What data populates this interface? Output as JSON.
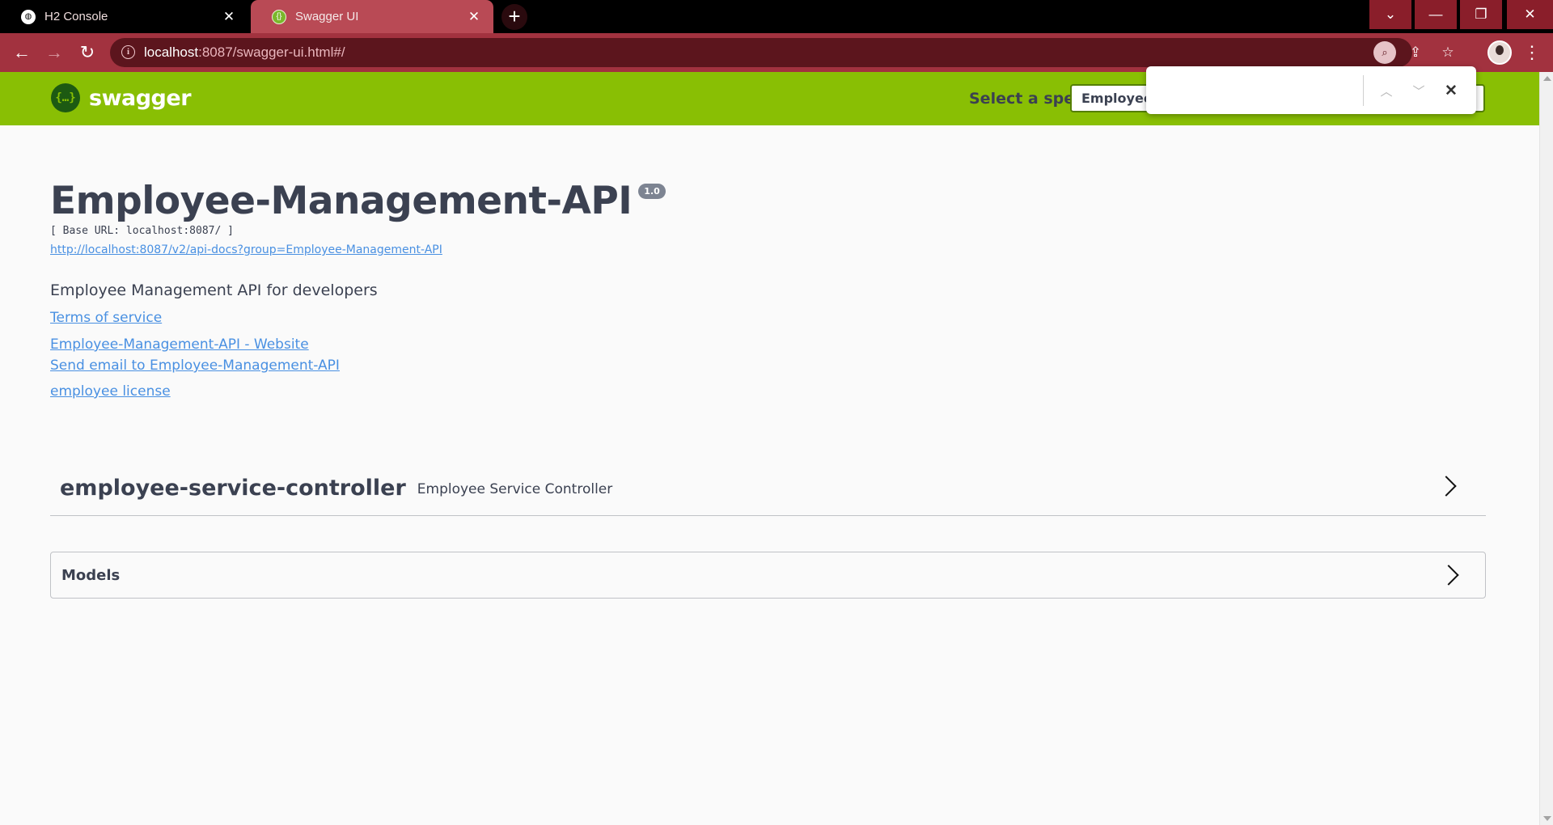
{
  "browser": {
    "tabs": [
      {
        "title": "H2 Console",
        "icon": "globe-icon",
        "active": false
      },
      {
        "title": "Swagger UI",
        "icon": "swagger-icon",
        "active": true
      }
    ],
    "url_host": "localhost",
    "url_rest": ":8087/swagger-ui.html#/",
    "accent": "#a2323f"
  },
  "swagger": {
    "logo_text": "swagger",
    "select_label": "Select a spec",
    "selected_spec": "Employee-Management-API",
    "brand_color": "#89bf04"
  },
  "info": {
    "title": "Employee-Management-API",
    "version": "1.0",
    "base_url": "[ Base URL: localhost:8087/ ]",
    "docs_url": "http://localhost:8087/v2/api-docs?group=Employee-Management-API",
    "description": "Employee Management API for developers",
    "terms": "Terms of service",
    "website": "Employee-Management-API - Website",
    "email": "Send email to Employee-Management-API",
    "license": "employee license"
  },
  "tag": {
    "name": "employee-service-controller",
    "description": "Employee Service Controller"
  },
  "models": {
    "label": "Models"
  }
}
